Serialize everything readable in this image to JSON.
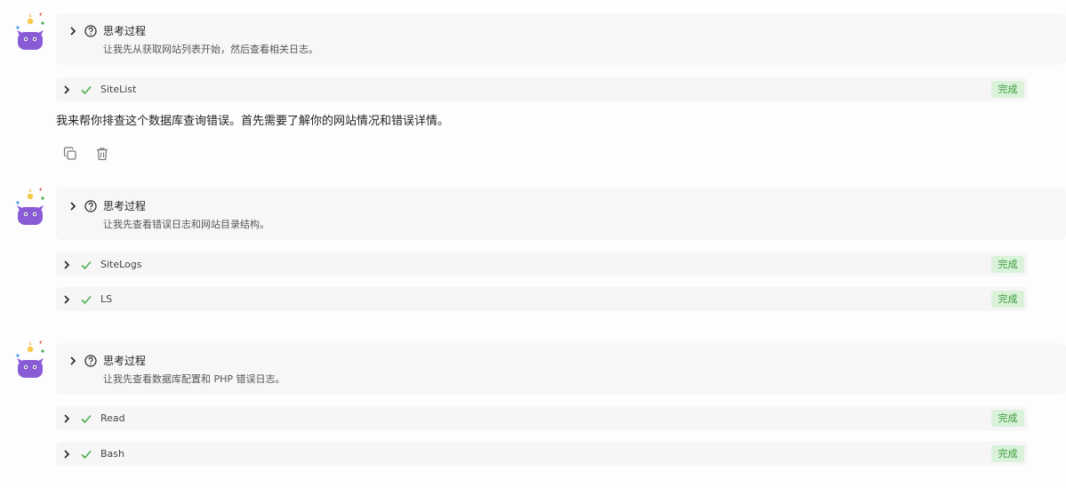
{
  "groups": [
    {
      "think_title": "思考过程",
      "think_desc": "让我先从获取网站列表开始，然后查看相关日志。",
      "tools": [
        {
          "name": "SiteList",
          "status": "完成"
        }
      ],
      "message": "我来帮你排查这个数据库查询错误。首先需要了解你的网站情况和错误详情。"
    },
    {
      "think_title": "思考过程",
      "think_desc": "让我先查看错误日志和网站目录结构。",
      "tools": [
        {
          "name": "SiteLogs",
          "status": "完成"
        },
        {
          "name": "LS",
          "status": "完成"
        }
      ]
    },
    {
      "think_title": "思考过程",
      "think_desc": "让我先查看数据库配置和 PHP 错误日志。",
      "tools": [
        {
          "name": "Read",
          "status": "完成"
        },
        {
          "name": "Bash",
          "status": "完成"
        }
      ]
    }
  ],
  "icons": {
    "avatar": "purple-monster-avatar-icon",
    "expand": "chevron-right-icon",
    "think": "question-circle-icon",
    "done": "check-icon",
    "copy": "copy-icon",
    "delete": "trash-icon"
  },
  "colors": {
    "badge_bg": "#d9f2d9",
    "badge_text": "#3a9a3a",
    "check": "#4caf50",
    "avatar": "#8a5bd6"
  }
}
